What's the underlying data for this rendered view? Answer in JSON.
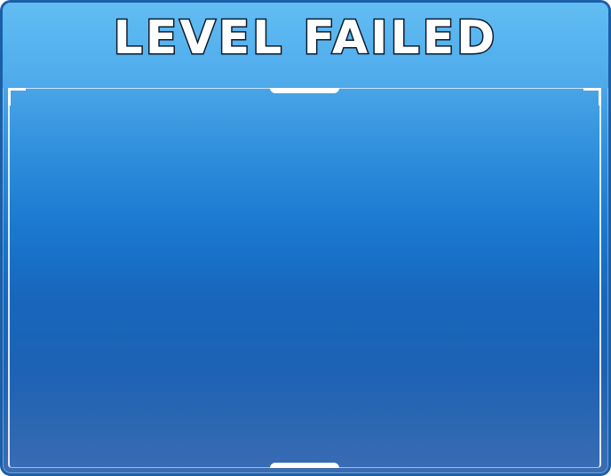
{
  "dialog": {
    "title": "LEVEL FAILED"
  },
  "colors": {
    "panel_top": "#5ab4ee",
    "panel_mid": "#1a78cf",
    "panel_bottom": "#3a6db4",
    "border": "#1a5fa8",
    "title_fill": "#ffffff",
    "title_outline": "#0d1a2a"
  }
}
